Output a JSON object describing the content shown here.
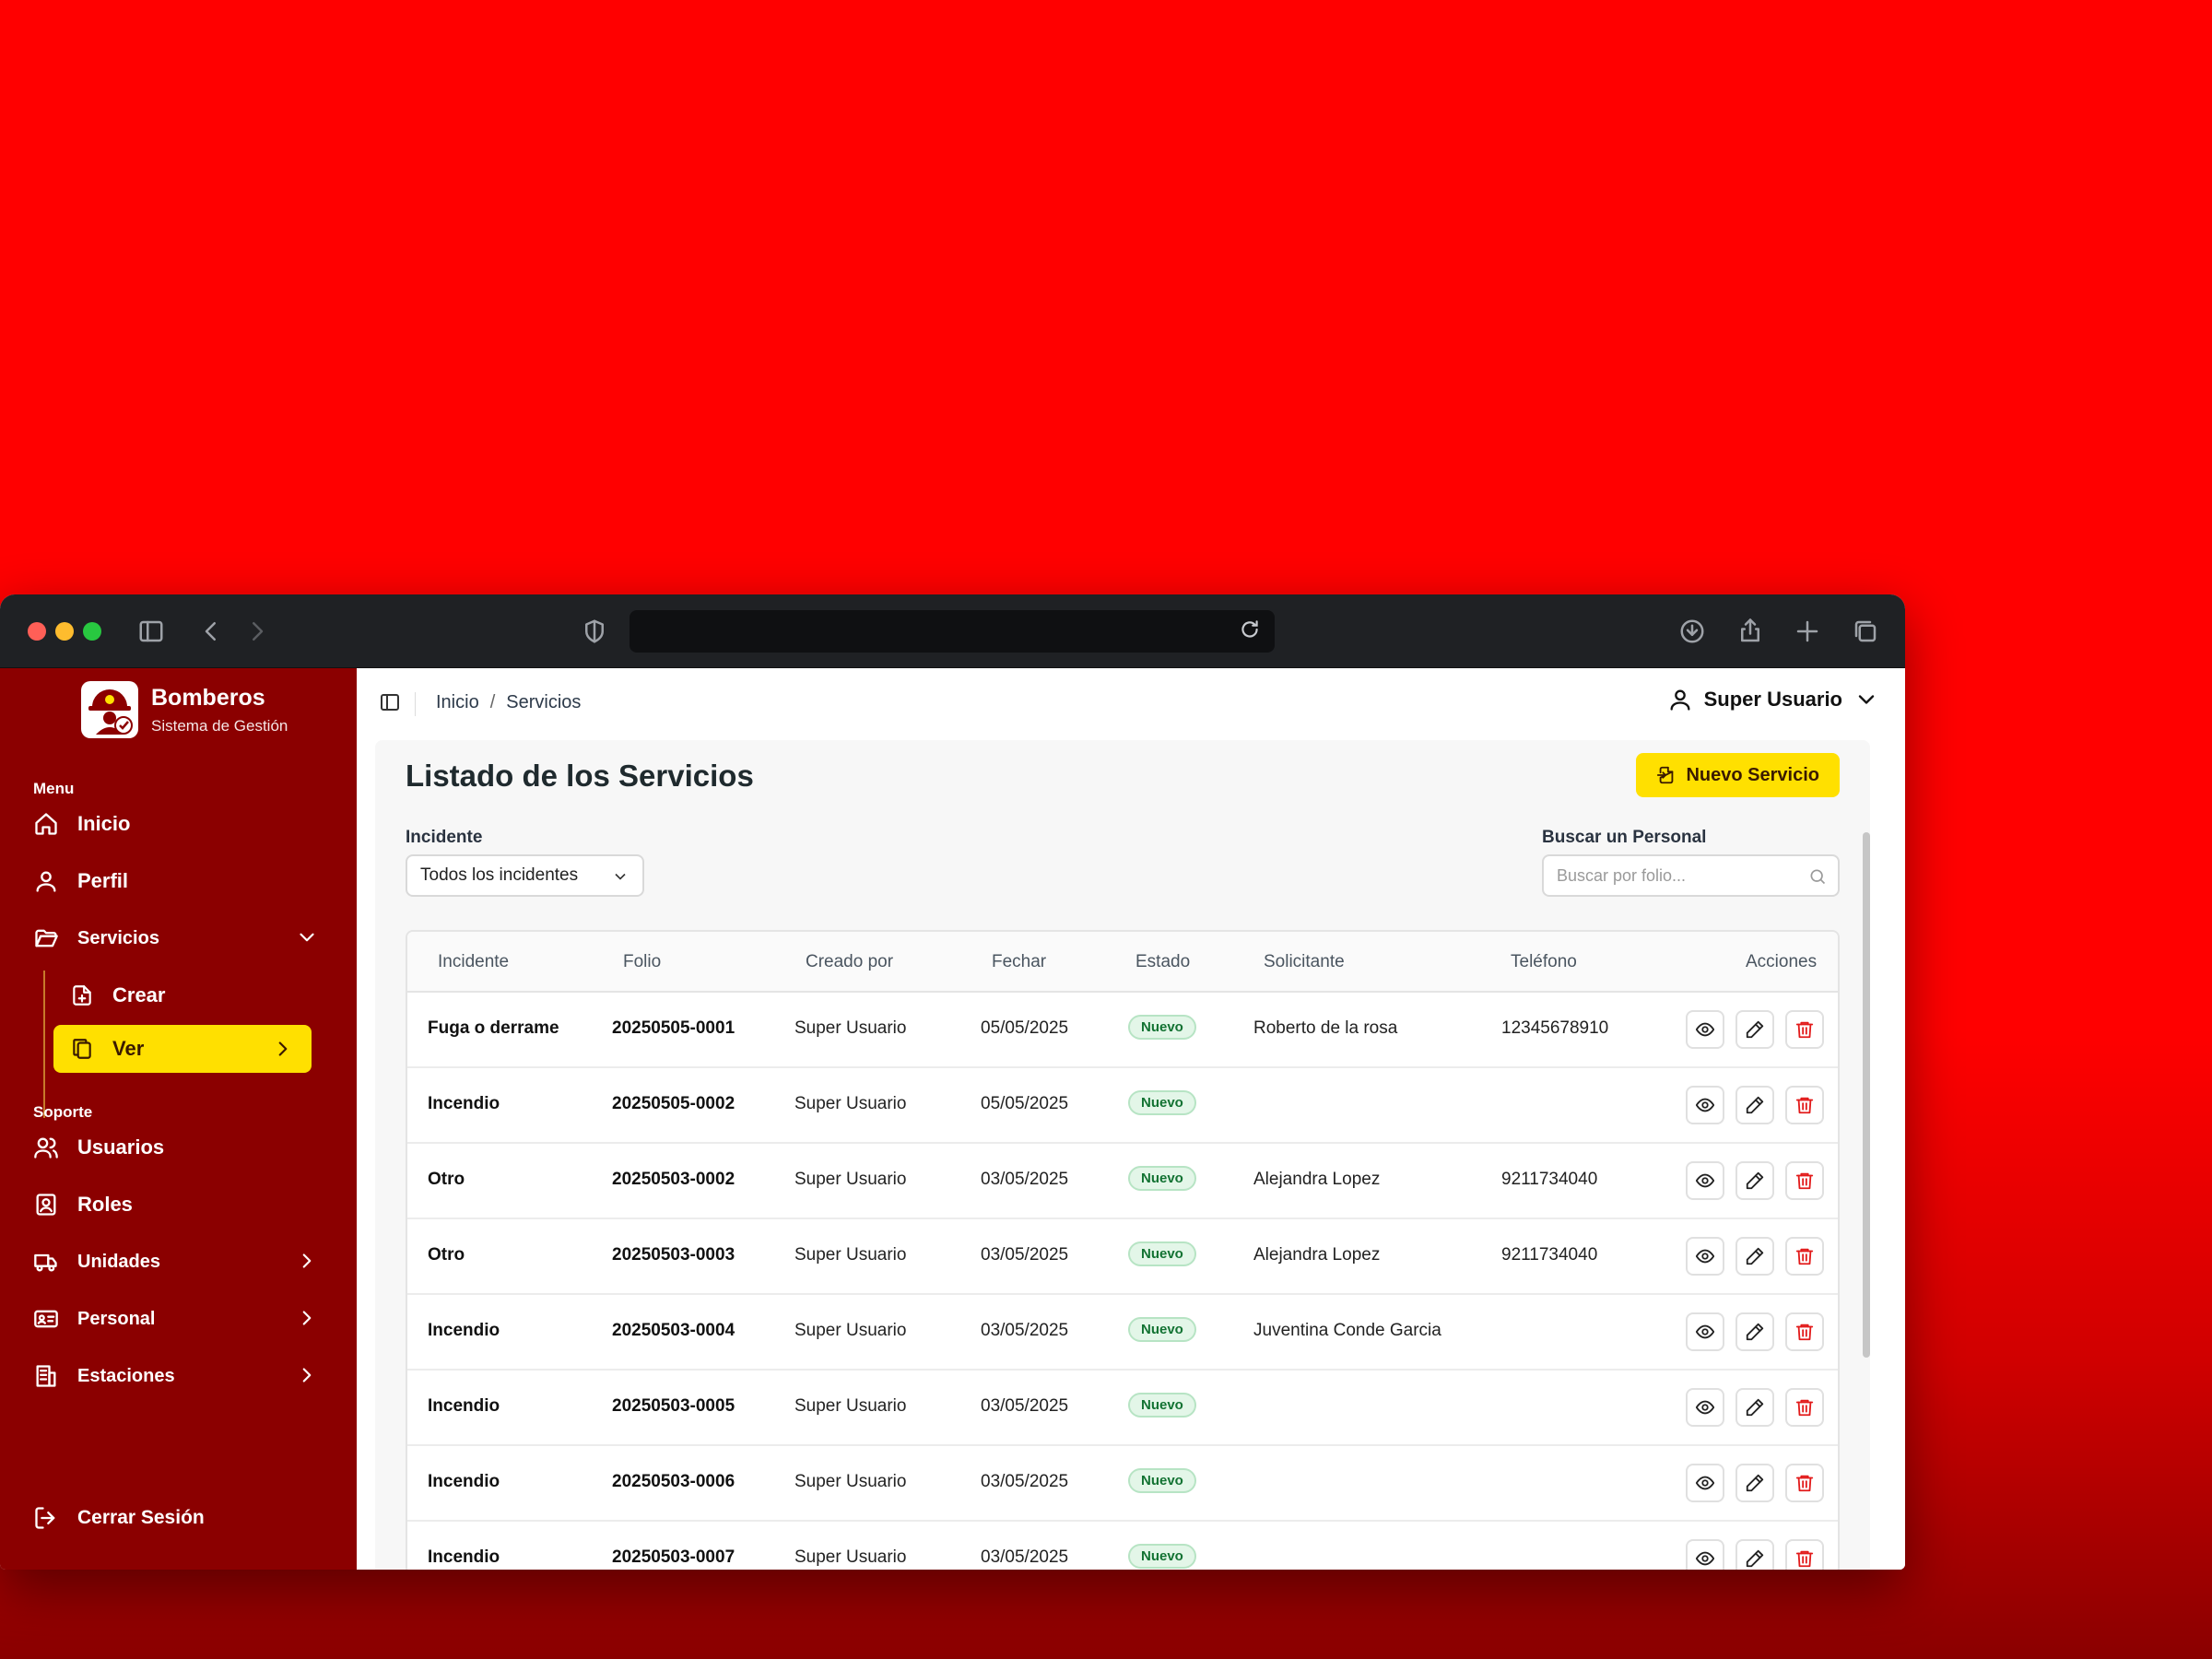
{
  "brand": {
    "title": "Bomberos",
    "subtitle": "Sistema de Gestión"
  },
  "sidebar": {
    "menu_label": "Menu",
    "support_label": "Soporte",
    "items": {
      "inicio": "Inicio",
      "perfil": "Perfil",
      "servicios": "Servicios",
      "crear": "Crear",
      "ver": "Ver",
      "usuarios": "Usuarios",
      "roles": "Roles",
      "unidades": "Unidades",
      "personal": "Personal",
      "estaciones": "Estaciones"
    },
    "logout": "Cerrar Sesión"
  },
  "breadcrumb": {
    "home": "Inicio",
    "separator": "/",
    "current": "Servicios"
  },
  "user": {
    "name": "Super Usuario"
  },
  "page": {
    "title": "Listado de los Servicios",
    "new_button": "Nuevo Servicio",
    "incident_label": "Incidente",
    "incident_value": "Todos los incidentes",
    "search_label": "Buscar un Personal",
    "search_placeholder": "Buscar por folio..."
  },
  "table": {
    "headers": {
      "incidente": "Incidente",
      "folio": "Folio",
      "creado": "Creado por",
      "fecha": "Fechar",
      "estado": "Estado",
      "solicitante": "Solicitante",
      "telefono": "Teléfono",
      "acciones": "Acciones"
    },
    "rows": [
      {
        "incidente": "Fuga o derrame",
        "folio": "20250505-0001",
        "creado": "Super Usuario",
        "fecha": "05/05/2025",
        "estado": "Nuevo",
        "solicitante": "Roberto de la rosa",
        "telefono": "12345678910"
      },
      {
        "incidente": "Incendio",
        "folio": "20250505-0002",
        "creado": "Super Usuario",
        "fecha": "05/05/2025",
        "estado": "Nuevo",
        "solicitante": "",
        "telefono": ""
      },
      {
        "incidente": "Otro",
        "folio": "20250503-0002",
        "creado": "Super Usuario",
        "fecha": "03/05/2025",
        "estado": "Nuevo",
        "solicitante": "Alejandra Lopez",
        "telefono": "9211734040"
      },
      {
        "incidente": "Otro",
        "folio": "20250503-0003",
        "creado": "Super Usuario",
        "fecha": "03/05/2025",
        "estado": "Nuevo",
        "solicitante": "Alejandra Lopez",
        "telefono": "9211734040"
      },
      {
        "incidente": "Incendio",
        "folio": "20250503-0004",
        "creado": "Super Usuario",
        "fecha": "03/05/2025",
        "estado": "Nuevo",
        "solicitante": "Juventina Conde Garcia",
        "telefono": ""
      },
      {
        "incidente": "Incendio",
        "folio": "20250503-0005",
        "creado": "Super Usuario",
        "fecha": "03/05/2025",
        "estado": "Nuevo",
        "solicitante": "",
        "telefono": ""
      },
      {
        "incidente": "Incendio",
        "folio": "20250503-0006",
        "creado": "Super Usuario",
        "fecha": "03/05/2025",
        "estado": "Nuevo",
        "solicitante": "",
        "telefono": ""
      },
      {
        "incidente": "Incendio",
        "folio": "20250503-0007",
        "creado": "Super Usuario",
        "fecha": "03/05/2025",
        "estado": "Nuevo",
        "solicitante": "",
        "telefono": ""
      }
    ]
  },
  "colors": {
    "sidebar": "#8b0000",
    "accent": "#ffe000",
    "background": "#ff0000",
    "badge_green": "#137333",
    "delete_red": "#e21b1b"
  }
}
